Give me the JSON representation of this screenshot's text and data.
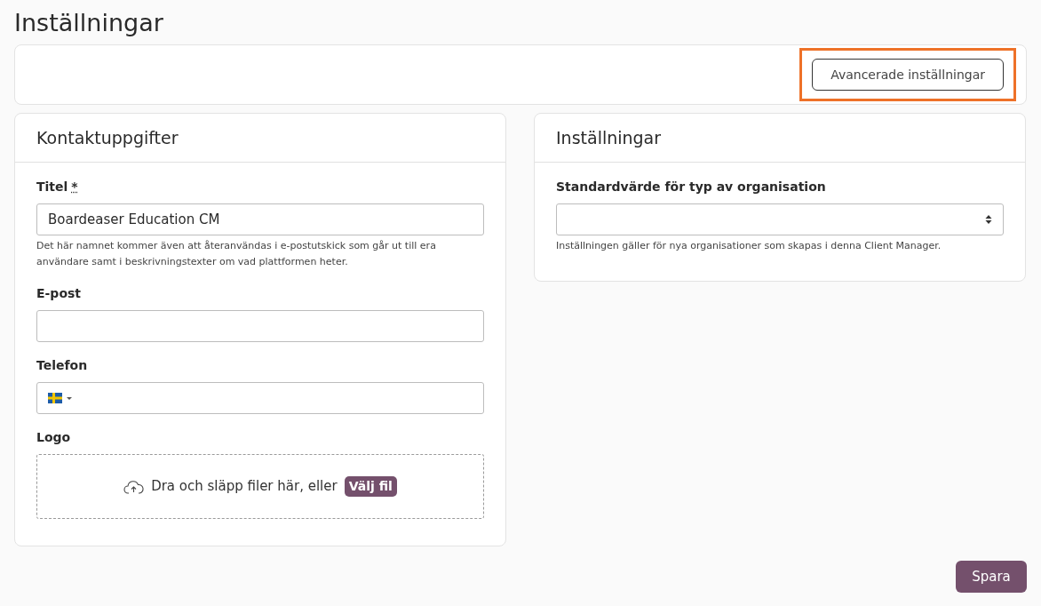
{
  "page_title": "Inställningar",
  "toolbar": {
    "button": {
      "label": "Avancerade inställningar",
      "highlighted": true
    }
  },
  "contact_card": {
    "title": "Kontaktuppgifter",
    "fields": [
      {
        "kind": "text",
        "label": "Titel",
        "required_mark": "*",
        "value": "Boardeaser Education CM",
        "help": "Det här namnet kommer även att återanvändas i e-postutskick som går ut till era användare samt i beskrivningstexter om vad plattformen heter."
      },
      {
        "kind": "text",
        "label": "E-post"
      },
      {
        "kind": "phone",
        "label": "Telefon"
      },
      {
        "kind": "upload",
        "label": "Logo",
        "text": "Dra och släpp filer här, eller",
        "button": "Välj fil"
      }
    ]
  },
  "settings_card": {
    "title": "Inställningar",
    "fields": [
      {
        "kind": "select",
        "label": "Standardvärde för typ av organisation",
        "help": "Inställningen gäller för nya organisationer som skapas i denna Client Manager."
      }
    ]
  },
  "save_button": "Spara"
}
